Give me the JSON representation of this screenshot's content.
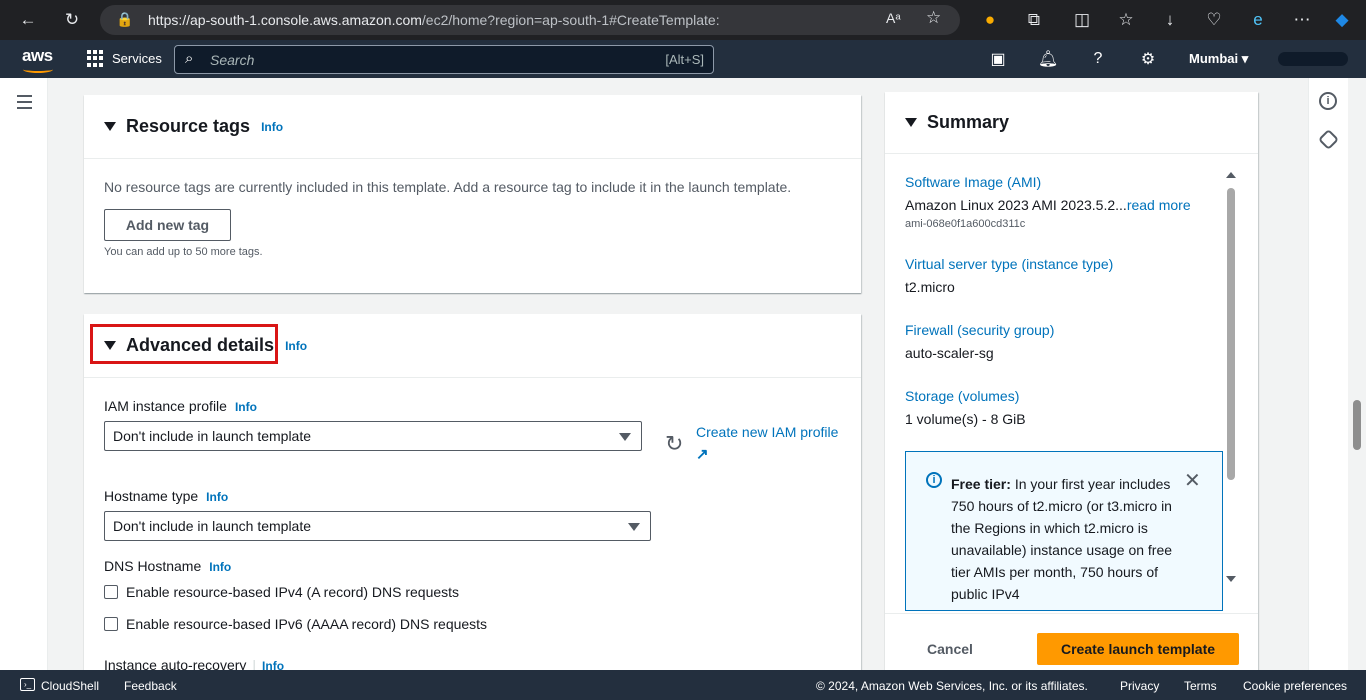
{
  "browser": {
    "url_host": "https://ap-south-1.console.aws.amazon.com",
    "url_path": "/ec2/home?region=ap-south-1#CreateTemplate:"
  },
  "aws_nav": {
    "logo": "aws",
    "services_label": "Services",
    "search_placeholder": "Search",
    "search_shortcut": "[Alt+S]",
    "region": "Mumbai ▾"
  },
  "resource_tags": {
    "title": "Resource tags",
    "info": "Info",
    "empty_text": "No resource tags are currently included in this template. Add a resource tag to include it in the launch template.",
    "add_button": "Add new tag",
    "hint": "You can add up to 50 more tags."
  },
  "advanced": {
    "title": "Advanced details",
    "info": "Info",
    "iam_label": "IAM instance profile",
    "iam_info": "Info",
    "iam_value": "Don't include in launch template",
    "create_iam_link": "Create new IAM profile",
    "hostname_label": "Hostname type",
    "hostname_info": "Info",
    "hostname_value": "Don't include in launch template",
    "dns_label": "DNS Hostname",
    "dns_info": "Info",
    "dns_ipv4": "Enable resource-based IPv4 (A record) DNS requests",
    "dns_ipv6": "Enable resource-based IPv6 (AAAA record) DNS requests",
    "recovery_label": "Instance auto-recovery",
    "recovery_info": "Info"
  },
  "summary": {
    "title": "Summary",
    "ami_label": "Software Image (AMI)",
    "ami_value": "Amazon Linux 2023 AMI 2023.5.2...",
    "ami_read_more": "read more",
    "ami_id": "ami-068e0f1a600cd311c",
    "instance_label": "Virtual server type (instance type)",
    "instance_value": "t2.micro",
    "firewall_label": "Firewall (security group)",
    "firewall_value": "auto-scaler-sg",
    "storage_label": "Storage (volumes)",
    "storage_value": "1 volume(s) - 8 GiB",
    "alert_title": "Free tier:",
    "alert_text": "In your first year includes 750 hours of t2.micro (or t3.micro in the Regions in which t2.micro is unavailable) instance usage on free tier AMIs per month, 750 hours of public IPv4",
    "cancel": "Cancel",
    "create": "Create launch template"
  },
  "footer": {
    "cloudshell": "CloudShell",
    "feedback": "Feedback",
    "copyright": "© 2024, Amazon Web Services, Inc. or its affiliates.",
    "privacy": "Privacy",
    "terms": "Terms",
    "cookies": "Cookie preferences"
  },
  "colors": {
    "nav_bg": "#232f3e",
    "link": "#0073bb",
    "primary": "#ec7211",
    "highlight": "#d91515"
  }
}
